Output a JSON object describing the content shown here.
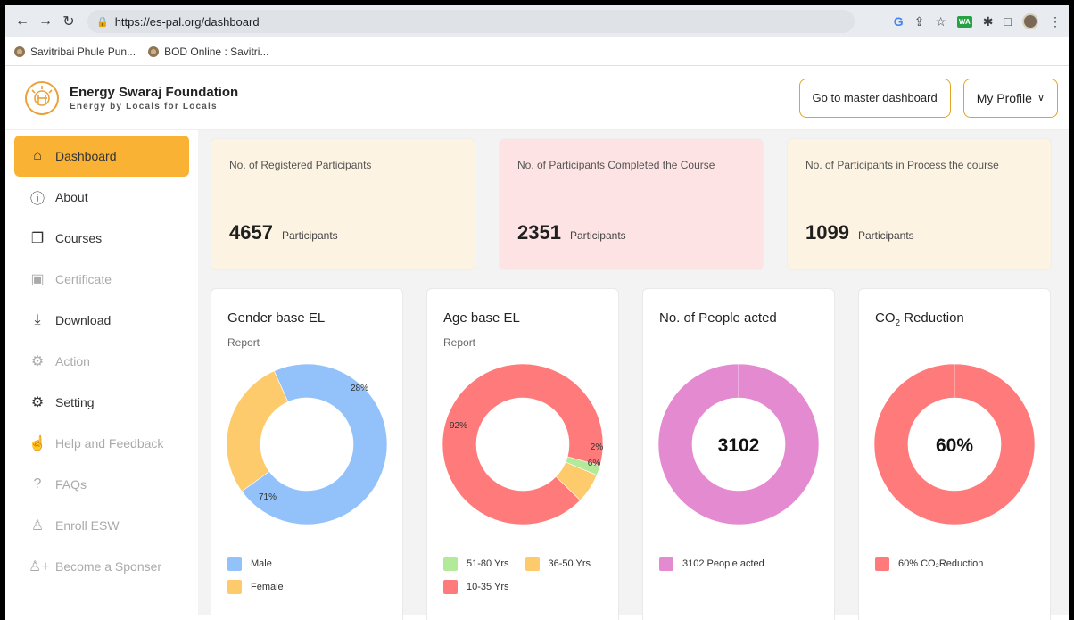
{
  "browser": {
    "url": "https://es-pal.org/dashboard",
    "bookmarks": [
      "Savitribai Phule Pun...",
      "BOD Online : Savitri..."
    ],
    "ext_wa": "WA"
  },
  "header": {
    "brand_name": "Energy Swaraj Foundation",
    "brand_tagline": "Energy by Locals for Locals",
    "master_button": "Go to master dashboard",
    "profile_button": "My Profile",
    "profile_chevron": "∨"
  },
  "sidebar": {
    "items": [
      {
        "label": "Dashboard",
        "icon": "home-icon",
        "glyph": "⌂",
        "state": "active"
      },
      {
        "label": "About",
        "icon": "info-icon",
        "glyph": "ⓘ",
        "state": "enabled"
      },
      {
        "label": "Courses",
        "icon": "courses-icon",
        "glyph": "❐",
        "state": "enabled"
      },
      {
        "label": "Certificate",
        "icon": "certificate-icon",
        "glyph": "▣",
        "state": "disabled"
      },
      {
        "label": "Download",
        "icon": "download-icon",
        "glyph": "⤓",
        "state": "enabled"
      },
      {
        "label": "Action",
        "icon": "action-gear-icon",
        "glyph": "⚙",
        "state": "disabled"
      },
      {
        "label": "Setting",
        "icon": "gear-icon",
        "glyph": "⚙",
        "state": "enabled"
      },
      {
        "label": "Help and Feedback",
        "icon": "thumbs-up-icon",
        "glyph": "☝",
        "state": "disabled"
      },
      {
        "label": "FAQs",
        "icon": "question-icon",
        "glyph": "?",
        "state": "disabled"
      },
      {
        "label": "Enroll ESW",
        "icon": "user-icon",
        "glyph": "♙",
        "state": "disabled"
      },
      {
        "label": "Become a Sponser",
        "icon": "add-user-icon",
        "glyph": "♙+",
        "state": "disabled"
      }
    ]
  },
  "stats": [
    {
      "label": "No. of Registered Participants",
      "value": "4657",
      "unit": "Participants",
      "bg": "#fdf3e2"
    },
    {
      "label": "No. of Participants Completed the Course",
      "value": "2351",
      "unit": "Participants",
      "bg": "#fde3e3"
    },
    {
      "label": "No. of Participants in Process the course",
      "value": "1099",
      "unit": "Participants",
      "bg": "#fdf3e2"
    }
  ],
  "colors": {
    "accent": "#f9b233",
    "male": "#93c2fb",
    "female": "#fdca6c",
    "age_young": "#ff7a7a",
    "age_old": "#b2ea9a",
    "people": "#e48ad0",
    "co2": "#ff7a7a"
  },
  "cards": [
    {
      "title": "Gender base EL",
      "subtitle": "Report"
    },
    {
      "title": "Age base EL",
      "subtitle": "Report"
    },
    {
      "title": "No. of People acted",
      "subtitle": ""
    },
    {
      "title": "CO",
      "title_sub": "2",
      "title_rest": " Reduction",
      "subtitle": ""
    }
  ],
  "chart_data": [
    {
      "type": "pie",
      "title": "Gender base EL",
      "subtitle": "Report",
      "labels": [
        "Male",
        "Female"
      ],
      "values": [
        71,
        28
      ],
      "value_labels": [
        "71%",
        "28%"
      ],
      "colors": [
        "#93c2fb",
        "#fdca6c"
      ],
      "legend": "bottom"
    },
    {
      "type": "pie",
      "title": "Age base EL",
      "subtitle": "Report",
      "labels": [
        "10-35 Yrs",
        "51-80 Yrs",
        "36-50 Yrs"
      ],
      "values": [
        92,
        2,
        6
      ],
      "value_labels": [
        "92%",
        "2%",
        "6%"
      ],
      "legend_order": [
        "51-80 Yrs",
        "36-50 Yrs",
        "10-35 Yrs"
      ],
      "colors": [
        "#ff7a7a",
        "#b2ea9a",
        "#fdca6c"
      ],
      "legend": "bottom"
    },
    {
      "type": "pie",
      "title": "No. of People acted",
      "labels": [
        "3102 People acted"
      ],
      "values": [
        3102
      ],
      "center_text": "3102",
      "colors": [
        "#e48ad0"
      ],
      "legend": "bottom"
    },
    {
      "type": "pie",
      "title": "CO2 Reduction",
      "labels": [
        "60% CO₂Reduction"
      ],
      "values": [
        60
      ],
      "center_text": "60%",
      "colors": [
        "#ff7a7a"
      ],
      "legend": "bottom"
    }
  ]
}
